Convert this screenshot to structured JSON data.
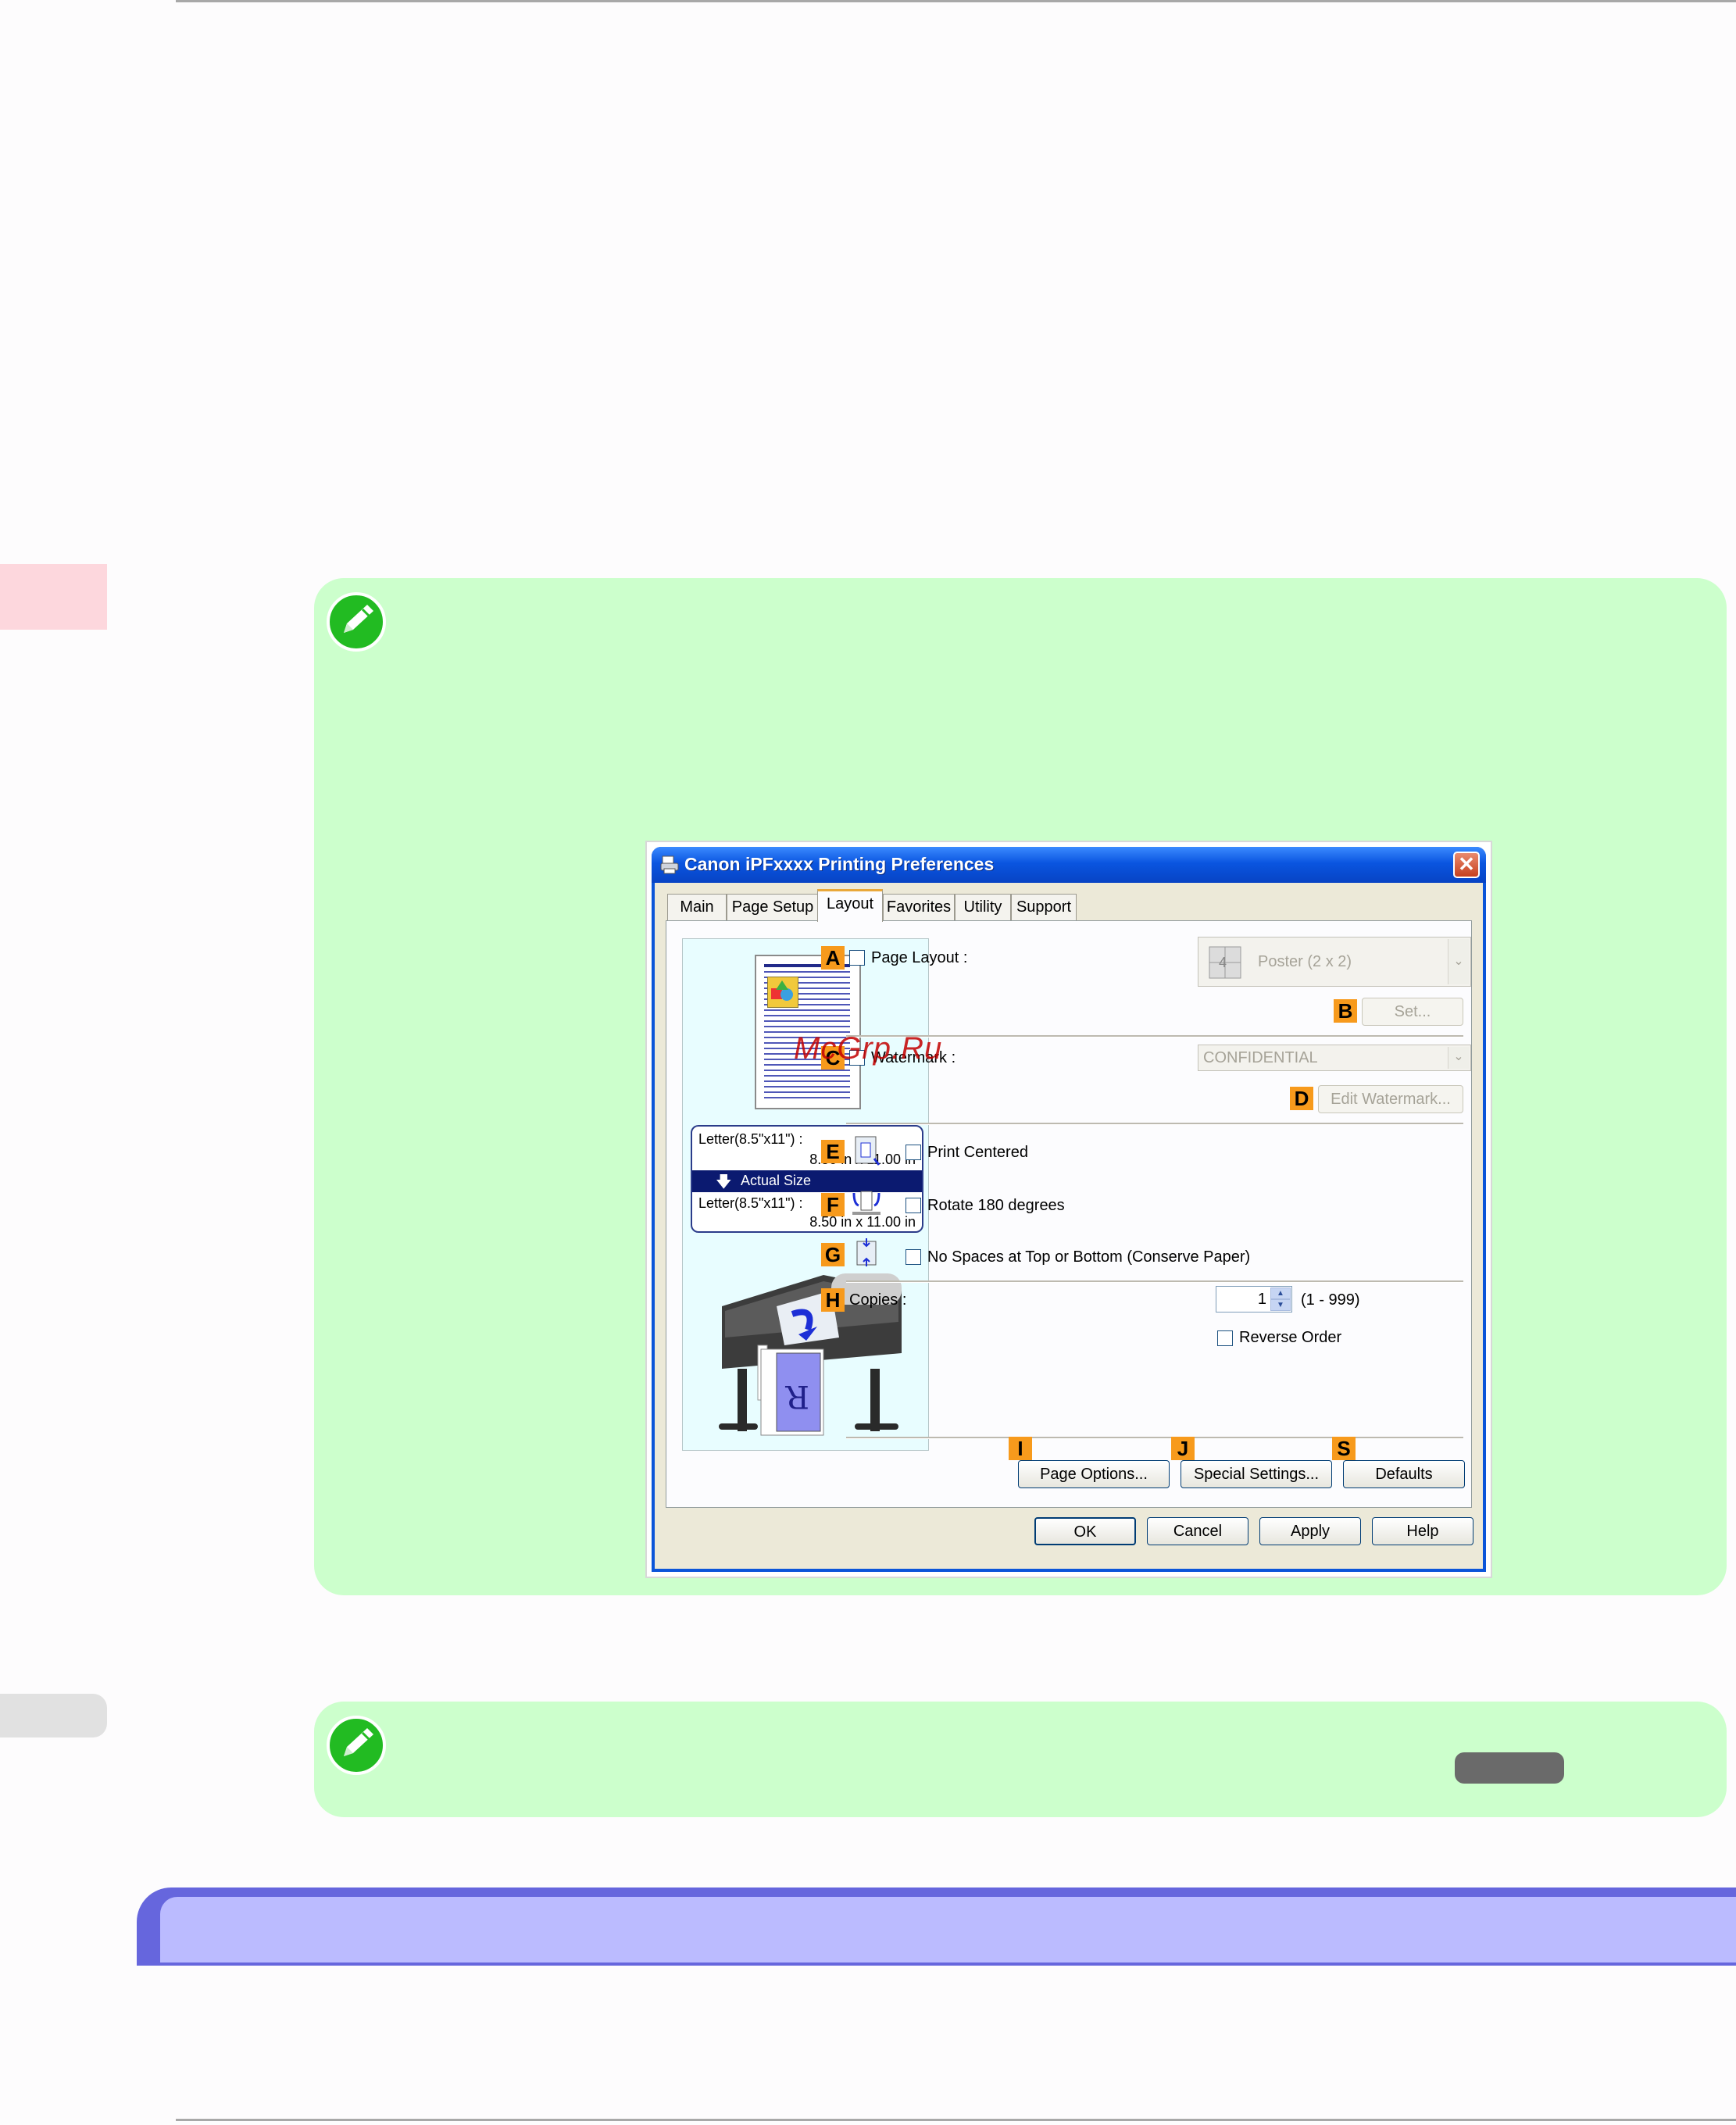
{
  "dialog": {
    "title": "Canon iPFxxxx Printing Preferences",
    "close_glyph": "✕",
    "tabs": [
      {
        "label": "Main"
      },
      {
        "label": "Page Setup"
      },
      {
        "label": "Layout",
        "active": true
      },
      {
        "label": "Favorites"
      },
      {
        "label": "Utility"
      },
      {
        "label": "Support"
      }
    ],
    "preview": {
      "source_size": "Letter(8.5\"x11\") :",
      "source_dims": "8.50 in x 11.00 in",
      "scaling": "Actual Size",
      "output_size": "Letter(8.5\"x11\") :",
      "output_dims": "8.50 in x 11.00 in"
    },
    "markers": {
      "A": "A",
      "B": "B",
      "C": "C",
      "D": "D",
      "E": "E",
      "F": "F",
      "G": "G",
      "H": "H",
      "I": "I",
      "J": "J",
      "S": "S"
    },
    "options": {
      "page_layout_label": "Page Layout :",
      "page_layout_value": "Poster (2 x 2)",
      "set_button": "Set...",
      "watermark_label": "Watermark :",
      "watermark_value": "CONFIDENTIAL",
      "edit_watermark_button": "Edit Watermark...",
      "print_centered_label": "Print Centered",
      "rotate_label": "Rotate 180 degrees",
      "no_spaces_label": "No Spaces at Top or Bottom (Conserve Paper)",
      "copies_label": "Copies :",
      "copies_value": "1",
      "copies_range": "(1 - 999)",
      "reverse_order_label": "Reverse Order"
    },
    "buttons": {
      "page_options": "Page Options...",
      "special_settings": "Special Settings...",
      "defaults": "Defaults",
      "ok": "OK",
      "cancel": "Cancel",
      "apply": "Apply",
      "help": "Help"
    }
  },
  "watermark_overlay": "McGrp.Ru",
  "colors": {
    "note_background": "#ccffcc",
    "section_bar": "#6666dd",
    "section_bar_inner": "#bbbbff",
    "marker_orange": "#f79a1c"
  }
}
